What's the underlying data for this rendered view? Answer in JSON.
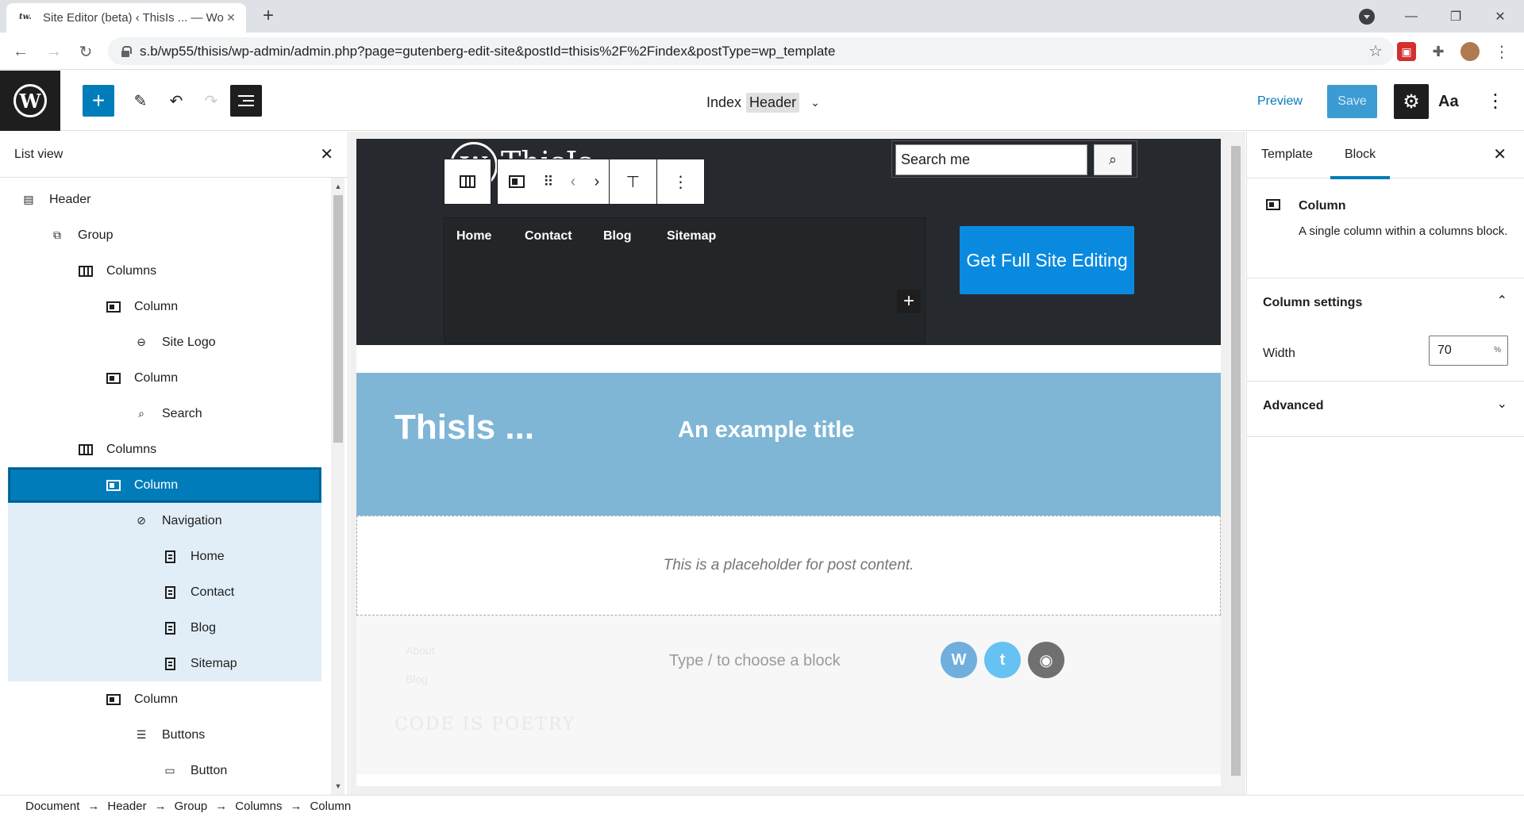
{
  "browser": {
    "tab_title": "Site Editor (beta) ‹ ThisIs ... — Wo",
    "tab_favicon": "tw.",
    "url": "s.b/wp55/thisis/wp-admin/admin.php?page=gutenberg-edit-site&postId=thisis%2F%2Findex&postType=wp_template"
  },
  "wp_header": {
    "doc_title": "Index",
    "template_part": "Header",
    "preview_label": "Preview",
    "save_label": "Save",
    "styles_label": "Aa"
  },
  "list_view": {
    "title": "List view",
    "items": [
      {
        "label": "Header",
        "icon": "template-part-icon",
        "depth": 0
      },
      {
        "label": "Group",
        "icon": "group-icon",
        "depth": 1
      },
      {
        "label": "Columns",
        "icon": "columns-icon",
        "depth": 2
      },
      {
        "label": "Column",
        "icon": "column-icon",
        "depth": 3
      },
      {
        "label": "Site Logo",
        "icon": "site-logo-icon",
        "depth": 4
      },
      {
        "label": "Column",
        "icon": "column-icon",
        "depth": 3
      },
      {
        "label": "Search",
        "icon": "search-icon",
        "depth": 4
      },
      {
        "label": "Columns",
        "icon": "columns-icon",
        "depth": 2
      },
      {
        "label": "Column",
        "icon": "column-icon",
        "depth": 3,
        "state": "selected"
      },
      {
        "label": "Navigation",
        "icon": "navigation-icon",
        "depth": 4,
        "state": "child"
      },
      {
        "label": "Home",
        "icon": "page-icon",
        "depth": 5,
        "state": "child"
      },
      {
        "label": "Contact",
        "icon": "page-icon",
        "depth": 5,
        "state": "child"
      },
      {
        "label": "Blog",
        "icon": "page-icon",
        "depth": 5,
        "state": "child"
      },
      {
        "label": "Sitemap",
        "icon": "page-icon",
        "depth": 5,
        "state": "child"
      },
      {
        "label": "Column",
        "icon": "column-icon",
        "depth": 3
      },
      {
        "label": "Buttons",
        "icon": "buttons-icon",
        "depth": 4
      },
      {
        "label": "Button",
        "icon": "button-icon",
        "depth": 5
      }
    ]
  },
  "breadcrumbs": [
    "Document",
    "Header",
    "Group",
    "Columns",
    "Column"
  ],
  "breadcrumb_sep": "→",
  "canvas": {
    "logo_text": "ThisIs",
    "search_value": "Search me",
    "nav_items": [
      "Home",
      "Contact",
      "Blog",
      "Sitemap"
    ],
    "fse_button": "Get Full Site Editing",
    "hero_site_title": "ThisIs ...",
    "hero_title": "An example title",
    "post_placeholder": "This is a placeholder for post content.",
    "footer_links": [
      "About",
      "Blog"
    ],
    "footer_hint": "Type / to choose a block",
    "footer_motto": "CODE IS POETRY",
    "social_colors": {
      "wordpress": "#70aede",
      "twitter": "#66c2f3",
      "github": "#707070"
    }
  },
  "sidebar": {
    "tabs": [
      "Template",
      "Block"
    ],
    "active_tab": "Block",
    "block_name": "Column",
    "block_desc": "A single column within a columns block.",
    "column_settings": "Column settings",
    "width_label": "Width",
    "width_value": "70",
    "width_unit": "%",
    "advanced": "Advanced"
  },
  "colors": {
    "accent": "#007cba",
    "header_bg": "#262a2e",
    "hero_bg": "#7fb6d6",
    "fse_button": "#0a8adf"
  }
}
